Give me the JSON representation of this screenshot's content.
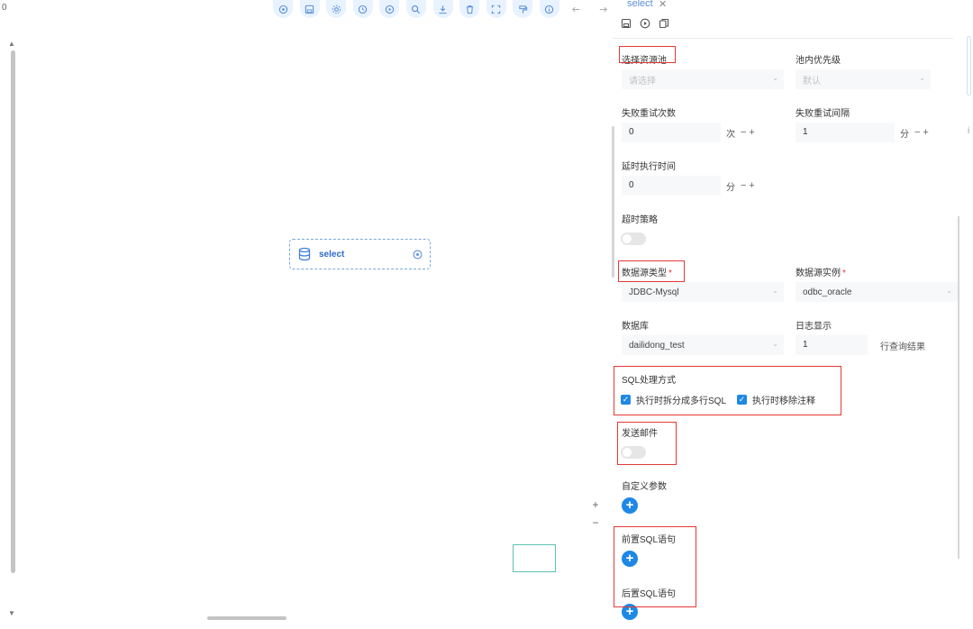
{
  "canvas": {
    "corner_glyph": "0",
    "node": {
      "label": "select"
    },
    "zoom": {
      "plus": "+",
      "minus": "−"
    },
    "scroll_up": "▲",
    "scroll_down": "▼"
  },
  "toolbar": {
    "icons": [
      "locate-icon",
      "save-icon",
      "settings-icon",
      "clock-icon",
      "play-icon",
      "search-icon",
      "download-icon",
      "delete-icon",
      "fullscreen-icon",
      "format-icon",
      "info-icon",
      "undo-icon",
      "redo-icon"
    ]
  },
  "drawer": {
    "tab_title": "select",
    "tab_close": "✕",
    "edge_text": "i",
    "form": {
      "resource_pool_label": "选择资源池",
      "resource_pool_placeholder": "请选择",
      "pool_priority_label": "池内优先级",
      "pool_priority_placeholder": "默认",
      "retry_count_label": "失败重试次数",
      "retry_count_value": "0",
      "retry_count_unit": "次",
      "retry_interval_label": "失败重试间隔",
      "retry_interval_value": "1",
      "retry_interval_unit": "分",
      "delay_label": "延时执行时间",
      "delay_value": "0",
      "delay_unit": "分",
      "stepper_controls": "−+",
      "timeout_label": "超时策略",
      "datasource_type_label": "数据源类型",
      "datasource_type_value": "JDBC-Mysql",
      "datasource_instance_label": "数据源实例",
      "datasource_instance_value": "odbc_oracle",
      "required_mark": "*",
      "database_label": "数据库",
      "database_value": "dailidong_test",
      "log_display_label": "日志显示",
      "log_display_value": "1",
      "log_display_suffix": "行查询结果",
      "sql_mode_label": "SQL处理方式",
      "sql_split_label": "执行时拆分成多行SQL",
      "sql_strip_comments_label": "执行时移除注释",
      "send_mail_label": "发送邮件",
      "custom_params_label": "自定义参数",
      "pre_sql_label": "前置SQL语句",
      "post_sql_label": "后置SQL语句",
      "add_symbol": "+",
      "check_symbol": "✓",
      "caret_symbol": "⌄"
    }
  },
  "colors": {
    "accent": "#1e88e5",
    "highlight_box": "#e53935",
    "node_border": "#7aa7e0",
    "minimap_border": "#5ec2b5"
  }
}
